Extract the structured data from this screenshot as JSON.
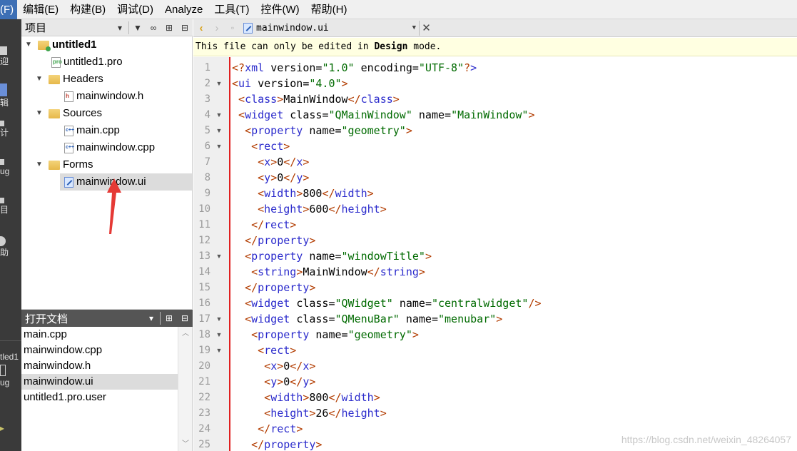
{
  "menubar": {
    "items": [
      "(F)",
      "编辑(E)",
      "构建(B)",
      "调试(D)",
      "Analyze",
      "工具(T)",
      "控件(W)",
      "帮助(H)"
    ]
  },
  "modebar": {
    "labels": [
      "迎",
      "辑",
      "计",
      "ug",
      "目",
      "助"
    ],
    "kit_label": "tled1",
    "bottom_label": "ug"
  },
  "project_pane": {
    "title": "项目",
    "tree": [
      {
        "label": "untitled1",
        "bold": true,
        "icon": "project-folder-icon",
        "expanded": true
      },
      {
        "label": "untitled1.pro",
        "icon": "pro-file-icon"
      },
      {
        "label": "Headers",
        "icon": "headers-folder-icon",
        "expanded": true
      },
      {
        "label": "mainwindow.h",
        "icon": "header-file-icon"
      },
      {
        "label": "Sources",
        "icon": "sources-folder-icon",
        "expanded": true
      },
      {
        "label": "main.cpp",
        "icon": "cpp-file-icon"
      },
      {
        "label": "mainwindow.cpp",
        "icon": "cpp-file-icon"
      },
      {
        "label": "Forms",
        "icon": "forms-folder-icon",
        "expanded": true
      },
      {
        "label": "mainwindow.ui",
        "icon": "ui-file-icon",
        "selected": true
      }
    ]
  },
  "open_docs": {
    "title": "打开文档",
    "items": [
      "main.cpp",
      "mainwindow.cpp",
      "mainwindow.h",
      "mainwindow.ui",
      "untitled1.pro.user"
    ],
    "selected": "mainwindow.ui"
  },
  "editor": {
    "current_file": "mainwindow.ui",
    "info": {
      "prefix": "This file can only be edited in ",
      "emphasis": "Design",
      "suffix": " mode."
    },
    "lines": [
      "<?xml version=\"1.0\" encoding=\"UTF-8\"?>",
      "<ui version=\"4.0\">",
      " <class>MainWindow</class>",
      " <widget class=\"QMainWindow\" name=\"MainWindow\">",
      "  <property name=\"geometry\">",
      "   <rect>",
      "    <x>0</x>",
      "    <y>0</y>",
      "    <width>800</width>",
      "    <height>600</height>",
      "   </rect>",
      "  </property>",
      "  <property name=\"windowTitle\">",
      "   <string>MainWindow</string>",
      "  </property>",
      "  <widget class=\"QWidget\" name=\"centralwidget\"/>",
      "  <widget class=\"QMenuBar\" name=\"menubar\">",
      "   <property name=\"geometry\">",
      "    <rect>",
      "     <x>0</x>",
      "     <y>0</y>",
      "     <width>800</width>",
      "     <height>26</height>",
      "    </rect>",
      "   </property>"
    ],
    "fold_lines": [
      2,
      4,
      5,
      6,
      13,
      17,
      18,
      19
    ]
  },
  "watermark": "https://blog.csdn.net/weixin_48264057",
  "colors": {
    "modebar_bg": "#3a3a3a",
    "selection": "#dcdcdc",
    "info_bg": "#ffffe1",
    "gutter_marker": "#e02020",
    "annotation_arrow": "#e53935"
  }
}
